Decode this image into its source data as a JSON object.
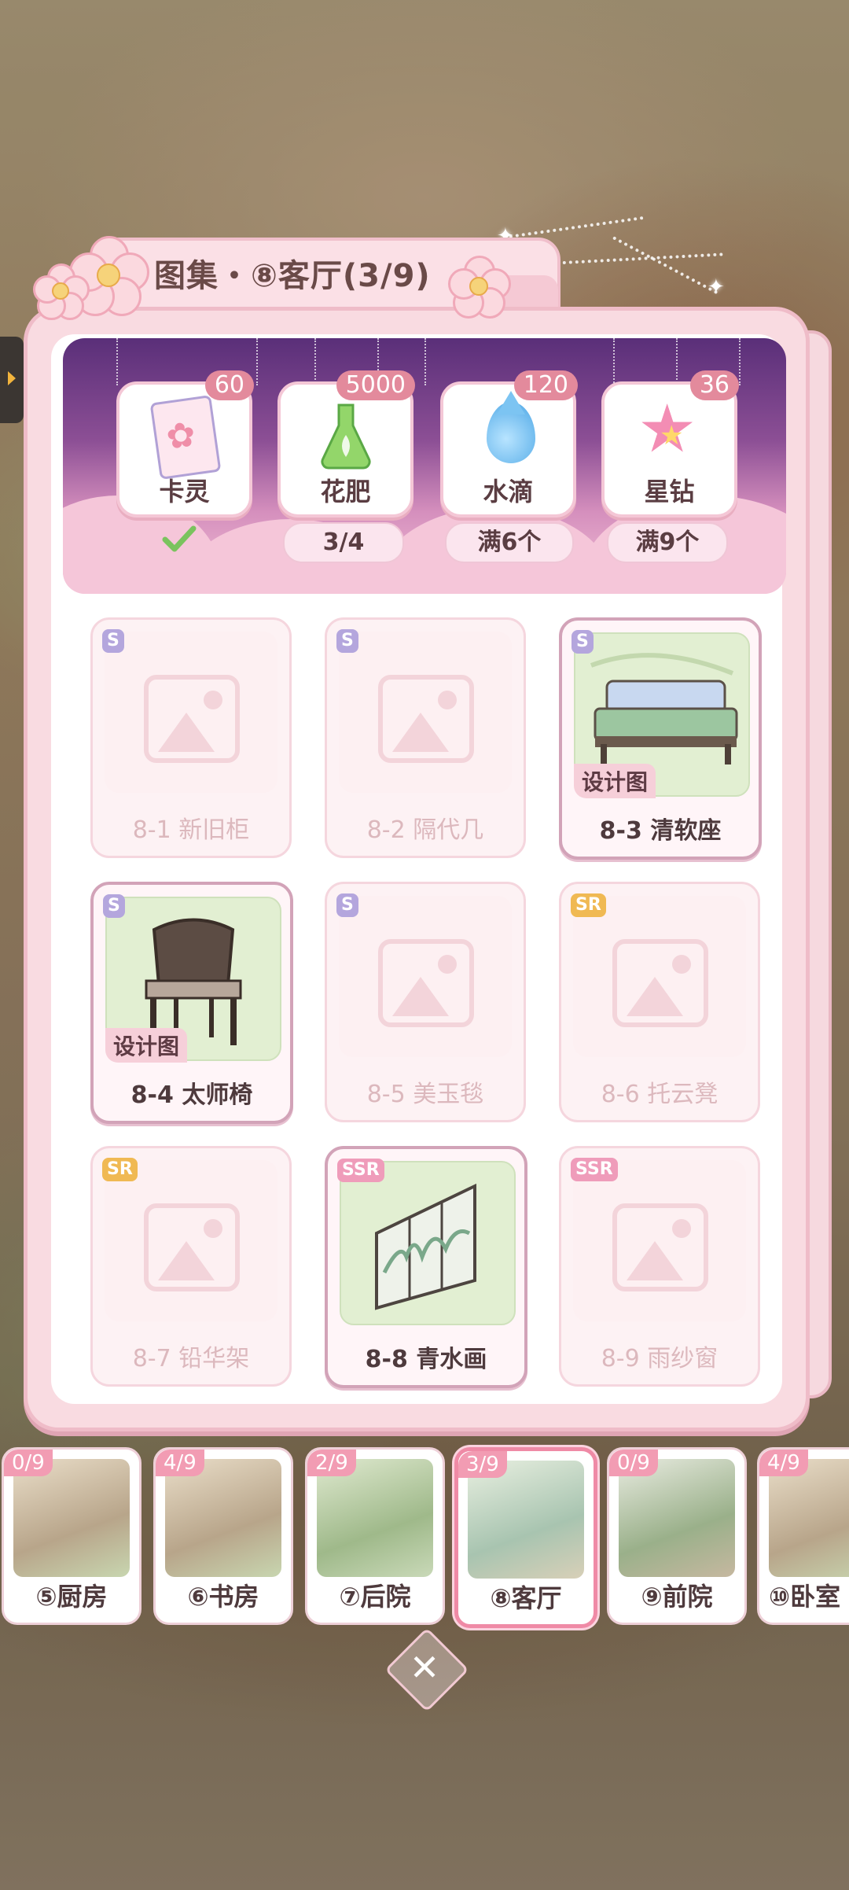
{
  "title": "图集・⑧客厅(3/9)",
  "rewards": [
    {
      "label": "卡灵",
      "count": "60",
      "status": "",
      "icon": "card-icon",
      "claimed": true
    },
    {
      "label": "花肥",
      "count": "5000",
      "status": "3/4",
      "icon": "fertilizer-icon"
    },
    {
      "label": "水滴",
      "count": "120",
      "status": "满6个",
      "icon": "water-drop-icon"
    },
    {
      "label": "星钻",
      "count": "36",
      "status": "满9个",
      "icon": "star-diamond-icon"
    }
  ],
  "items": [
    {
      "name": "8-1 新旧柜",
      "rarity": "S",
      "collected": false
    },
    {
      "name": "8-2 隔代几",
      "rarity": "S",
      "collected": false
    },
    {
      "name": "8-3 清软座",
      "rarity": "S",
      "collected": true,
      "tag": "设计图"
    },
    {
      "name": "8-4 太师椅",
      "rarity": "S",
      "collected": true,
      "tag": "设计图"
    },
    {
      "name": "8-5 美玉毯",
      "rarity": "S",
      "collected": false
    },
    {
      "name": "8-6 托云凳",
      "rarity": "SR",
      "collected": false
    },
    {
      "name": "8-7 铅华架",
      "rarity": "SR",
      "collected": false
    },
    {
      "name": "8-8 青水画",
      "rarity": "SSR",
      "collected": true
    },
    {
      "name": "8-9 雨纱窗",
      "rarity": "SSR",
      "collected": false
    }
  ],
  "rooms": [
    {
      "label": "⑤厨房",
      "count": "0/9"
    },
    {
      "label": "⑥书房",
      "count": "4/9"
    },
    {
      "label": "⑦后院",
      "count": "2/9"
    },
    {
      "label": "⑧客厅",
      "count": "3/9",
      "active": true
    },
    {
      "label": "⑨前院",
      "count": "0/9"
    },
    {
      "label": "⑩卧室",
      "count": "4/9"
    }
  ],
  "colors": {
    "accent": "#ef8aa6",
    "banner_top": "#5a2f79",
    "panel": "#f9dbe1"
  }
}
